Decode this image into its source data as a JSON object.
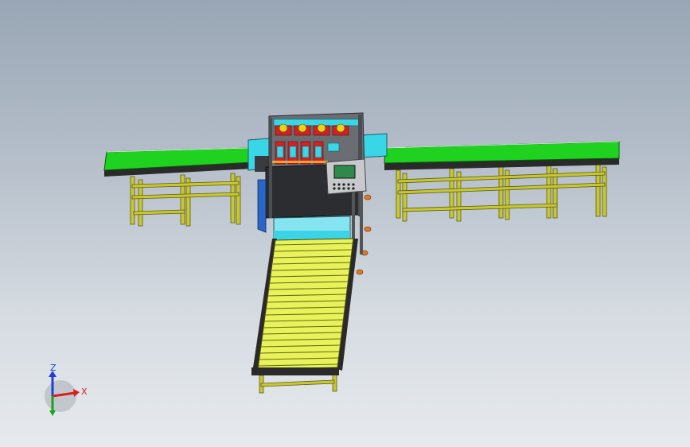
{
  "window": {
    "title": ""
  },
  "triad": {
    "z_label": "Z",
    "x_label": "X",
    "colors": {
      "z_axis": "#1f3fd9",
      "x_axis": "#d81f1f",
      "y_axis": "#1aa31a"
    }
  },
  "model": {
    "parts": [
      {
        "name": "left-conveyor",
        "color": "#1fd21f"
      },
      {
        "name": "right-conveyor",
        "color": "#1fd21f"
      },
      {
        "name": "roller-conveyor",
        "color": "#e8f25a"
      },
      {
        "name": "central-machine-body",
        "color": "#2b2d31"
      },
      {
        "name": "control-panel-screen",
        "color": "#2e8a4a"
      },
      {
        "name": "support-frames",
        "color": "#c8c830"
      },
      {
        "name": "red-clamps",
        "color": "#d42020"
      },
      {
        "name": "cyan-guards",
        "color": "#39d6e8"
      }
    ]
  }
}
